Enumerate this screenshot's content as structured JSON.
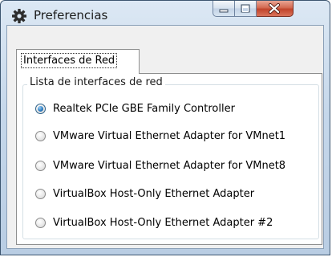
{
  "window": {
    "title": "Preferencias",
    "icon": "gear-icon"
  },
  "caption_buttons": [
    {
      "name": "minimize",
      "icon": "minimize-icon"
    },
    {
      "name": "maximize",
      "icon": "maximize-icon"
    },
    {
      "name": "close",
      "icon": "close-icon"
    }
  ],
  "tabs": [
    {
      "label": "Interfaces de Red",
      "active": true
    }
  ],
  "group": {
    "label": "Lista de interfaces de red"
  },
  "interfaces": [
    {
      "label": "Realtek PCIe GBE Family Controller",
      "selected": true
    },
    {
      "label": "VMware Virtual Ethernet Adapter for VMnet1",
      "selected": false
    },
    {
      "label": "VMware Virtual Ethernet Adapter for VMnet8",
      "selected": false
    },
    {
      "label": "VirtualBox Host-Only Ethernet Adapter",
      "selected": false
    },
    {
      "label": "VirtualBox Host-Only Ethernet Adapter #2",
      "selected": false
    }
  ],
  "colors": {
    "accent": "#2f7fc4",
    "close_button": "#c1442b",
    "frame": "#c5d7ea"
  }
}
